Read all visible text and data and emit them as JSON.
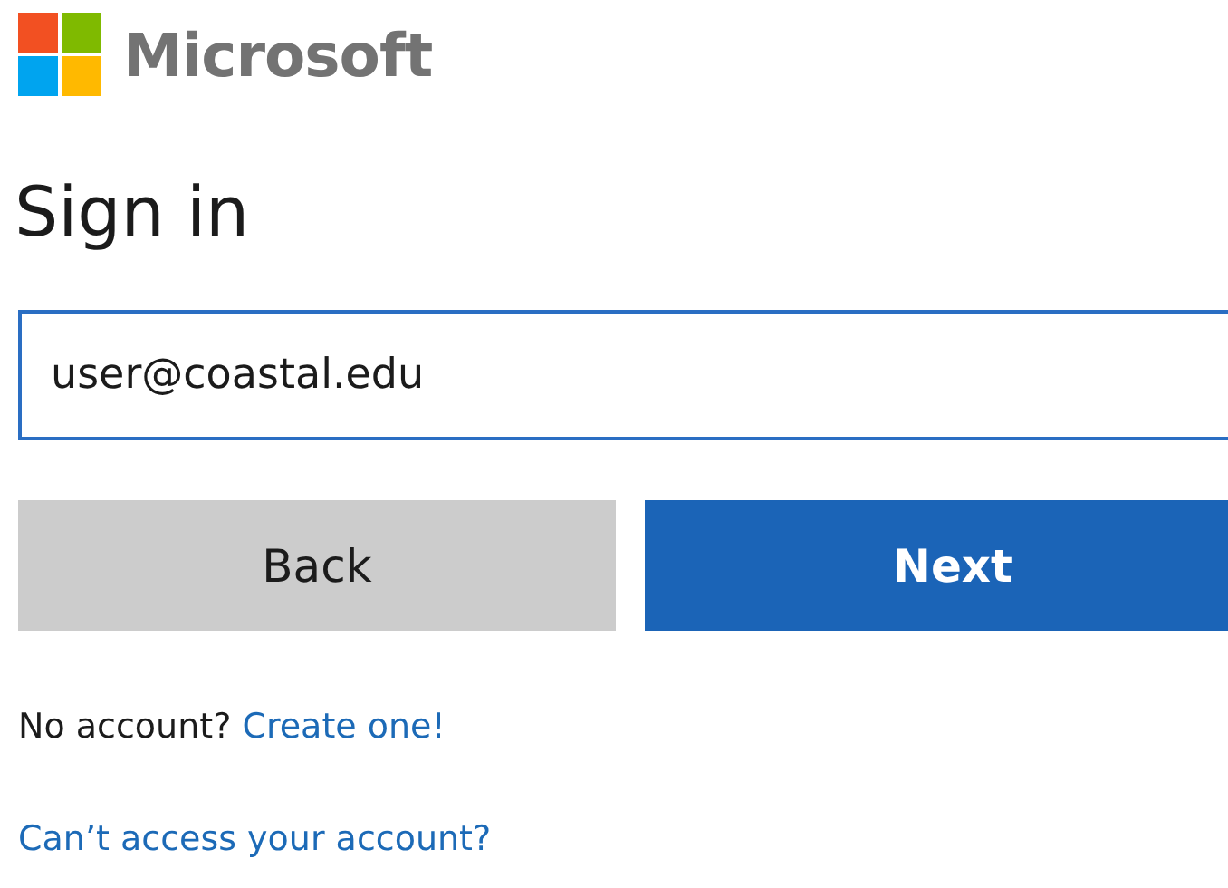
{
  "brand": {
    "name": "Microsoft"
  },
  "title": "Sign in",
  "email_field": {
    "value": "user@coastal.edu"
  },
  "buttons": [
    {
      "label": "Back",
      "kind": "secondary"
    },
    {
      "label": "Next",
      "kind": "primary"
    }
  ],
  "no_account": {
    "text": "No account?",
    "link": "Create one!"
  },
  "access_link": "Can’t access your account?"
}
